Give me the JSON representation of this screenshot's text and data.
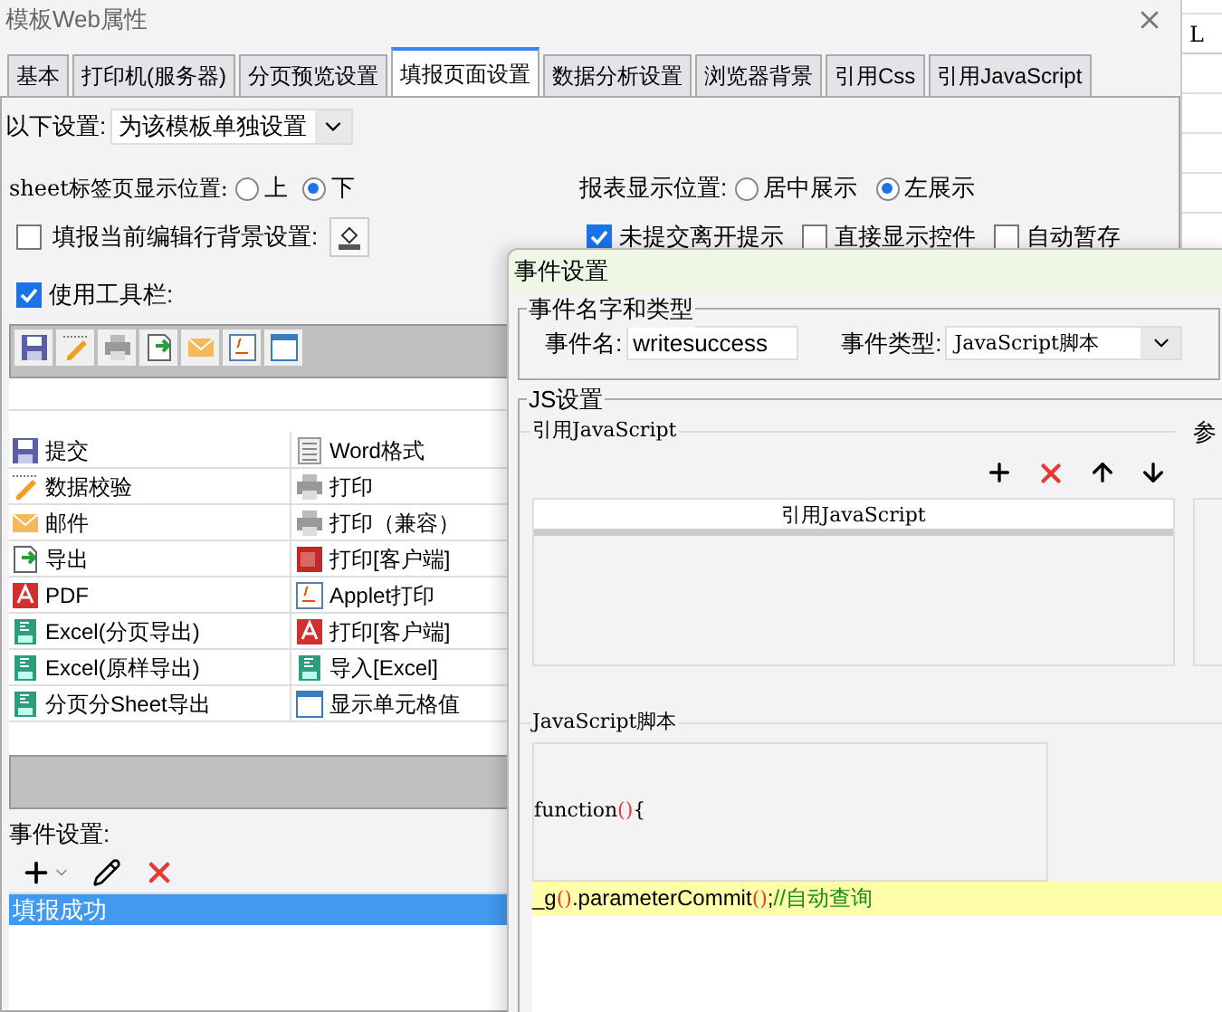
{
  "window": {
    "title": "模板Web属性"
  },
  "tabs": [
    {
      "label": "基本",
      "selected": false
    },
    {
      "label": "打印机(服务器)",
      "selected": false
    },
    {
      "label": "分页预览设置",
      "selected": false
    },
    {
      "label": "填报页面设置",
      "selected": true
    },
    {
      "label": "数据分析设置",
      "selected": false
    },
    {
      "label": "浏览器背景",
      "selected": false
    },
    {
      "label": "引用Css",
      "selected": false
    },
    {
      "label": "引用JavaScript",
      "selected": false
    }
  ],
  "scope": {
    "label": "以下设置:",
    "value": "为该模板单独设置"
  },
  "sheet_tab_position": {
    "label": "sheet标签页显示位置:",
    "options": [
      {
        "label": "上",
        "selected": false
      },
      {
        "label": "下",
        "selected": true
      }
    ]
  },
  "report_position": {
    "label": "报表显示位置:",
    "options": [
      {
        "label": "居中展示",
        "selected": false
      },
      {
        "label": "左展示",
        "selected": true
      }
    ]
  },
  "edit_row_background": {
    "label": "填报当前编辑行背景设置:",
    "checked": false
  },
  "options": [
    {
      "label": "未提交离开提示",
      "checked": true
    },
    {
      "label": "直接显示控件",
      "checked": false
    },
    {
      "label": "自动暂存",
      "checked": false
    }
  ],
  "use_toolbar": {
    "label": "使用工具栏:",
    "checked": true
  },
  "button_rows": [
    [
      "提交",
      "Word格式"
    ],
    [
      "数据校验",
      "打印"
    ],
    [
      "邮件",
      "打印（兼容）"
    ],
    [
      "导出",
      "打印[客户端]"
    ],
    [
      "PDF",
      "Applet打印"
    ],
    [
      "Excel(分页导出)",
      "打印[客户端]"
    ],
    [
      "Excel(原样导出)",
      "导入[Excel]"
    ],
    [
      "分页分Sheet导出",
      "显示单元格值"
    ]
  ],
  "event_settings": {
    "label": "事件设置:",
    "events": [
      {
        "label": "填报成功",
        "selected": true
      }
    ]
  },
  "sheet_column": "L",
  "dialog": {
    "title": "事件设置",
    "name_type_group": "事件名字和类型",
    "name_label": "事件名:",
    "name_value": "writesuccess",
    "type_label": "事件类型:",
    "type_value": "JavaScript脚本",
    "js_group": "JS设置",
    "ref_group": "引用JavaScript",
    "ref_column": "引用JavaScript",
    "param_group": "参",
    "script_group": "JavaScript脚本",
    "code_lines": [
      {
        "highlighted": false,
        "tokens": [
          {
            "kind": "plain",
            "text": "function"
          },
          {
            "kind": "paren",
            "text": "()"
          },
          {
            "kind": "plain",
            "text": "{"
          }
        ]
      },
      {
        "highlighted": true,
        "tokens": [
          {
            "kind": "plain",
            "text": "_g"
          },
          {
            "kind": "paren",
            "text": "()"
          },
          {
            "kind": "plain",
            "text": ".parameterCommit"
          },
          {
            "kind": "paren",
            "text": "()"
          },
          {
            "kind": "plain",
            "text": ";"
          },
          {
            "kind": "comment",
            "text": "//自动查询"
          }
        ]
      }
    ]
  }
}
